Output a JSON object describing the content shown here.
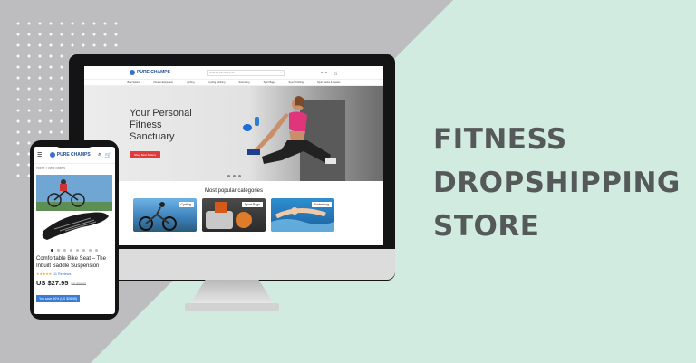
{
  "headline": [
    "FITNESS",
    "DROPSHIPPING",
    "STORE"
  ],
  "colors": {
    "background": "#d1ebe0",
    "accent_red": "#e03b3b",
    "accent_blue": "#3a7bd5",
    "headline": "#55595a"
  },
  "desktop": {
    "logo": "PURE CHAMPS",
    "search_placeholder": "What are you looking for?",
    "currency": "US $",
    "nav": [
      "Best Sellers",
      "Fitness Equipment",
      "Cycling",
      "Cycling Clothing",
      "Swimming",
      "Sport Bags",
      "Sport Clothing",
      "Sport Socks & Insoles"
    ],
    "hero_title": "Your Personal Fitness Sanctuary",
    "hero_button": "Shop Best Sellers",
    "popular_heading": "Most popular categories",
    "categories": [
      "Cycling",
      "Sport Bags",
      "Swimming"
    ]
  },
  "mobile": {
    "logo": "PURE CHAMPS",
    "breadcrumb": "Home  >  Best Sellers",
    "product_title": "Comfortable Bike Seat – The Inbuilt Saddle Suspension",
    "stars": "★★★★★",
    "reviews": "11 Reviews",
    "price": "US $27.95",
    "old_price": "US $55.90",
    "save_text": "You save 50% (US $28.95)"
  },
  "icons": [
    "search-icon",
    "cart-icon",
    "menu-icon",
    "apple-logo-icon"
  ]
}
